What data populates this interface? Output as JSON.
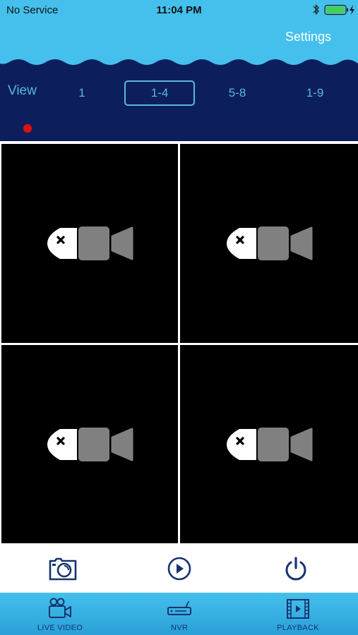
{
  "status_bar": {
    "carrier": "No Service",
    "time": "11:04 PM",
    "bluetooth_icon": "bluetooth-icon",
    "battery_icon": "battery-charging-icon"
  },
  "header": {
    "settings_label": "Settings",
    "view_label": "View",
    "view_options": [
      "1",
      "1-4",
      "5-8",
      "1-9"
    ],
    "selected_view": "1-4",
    "recording_indicator": "red-dot-icon"
  },
  "cameras": [
    {
      "status_icon": "no-signal-camera-icon"
    },
    {
      "status_icon": "no-signal-camera-icon"
    },
    {
      "status_icon": "no-signal-camera-icon"
    },
    {
      "status_icon": "no-signal-camera-icon"
    }
  ],
  "controls": {
    "snapshot_icon": "camera-snapshot-icon",
    "play_icon": "play-circle-icon",
    "power_icon": "power-icon"
  },
  "tabbar": {
    "tabs": [
      {
        "label": "LIVE VIDEO",
        "icon": "video-camera-icon"
      },
      {
        "label": "NVR",
        "icon": "nvr-device-icon"
      },
      {
        "label": "PLAYBACK",
        "icon": "film-play-icon"
      }
    ]
  },
  "colors": {
    "header_dark": "#0c1f5c",
    "sky": "#45c0ec",
    "view_accent": "#5ab6dd",
    "icon_navy": "#16336e",
    "record_red": "#e01010"
  }
}
